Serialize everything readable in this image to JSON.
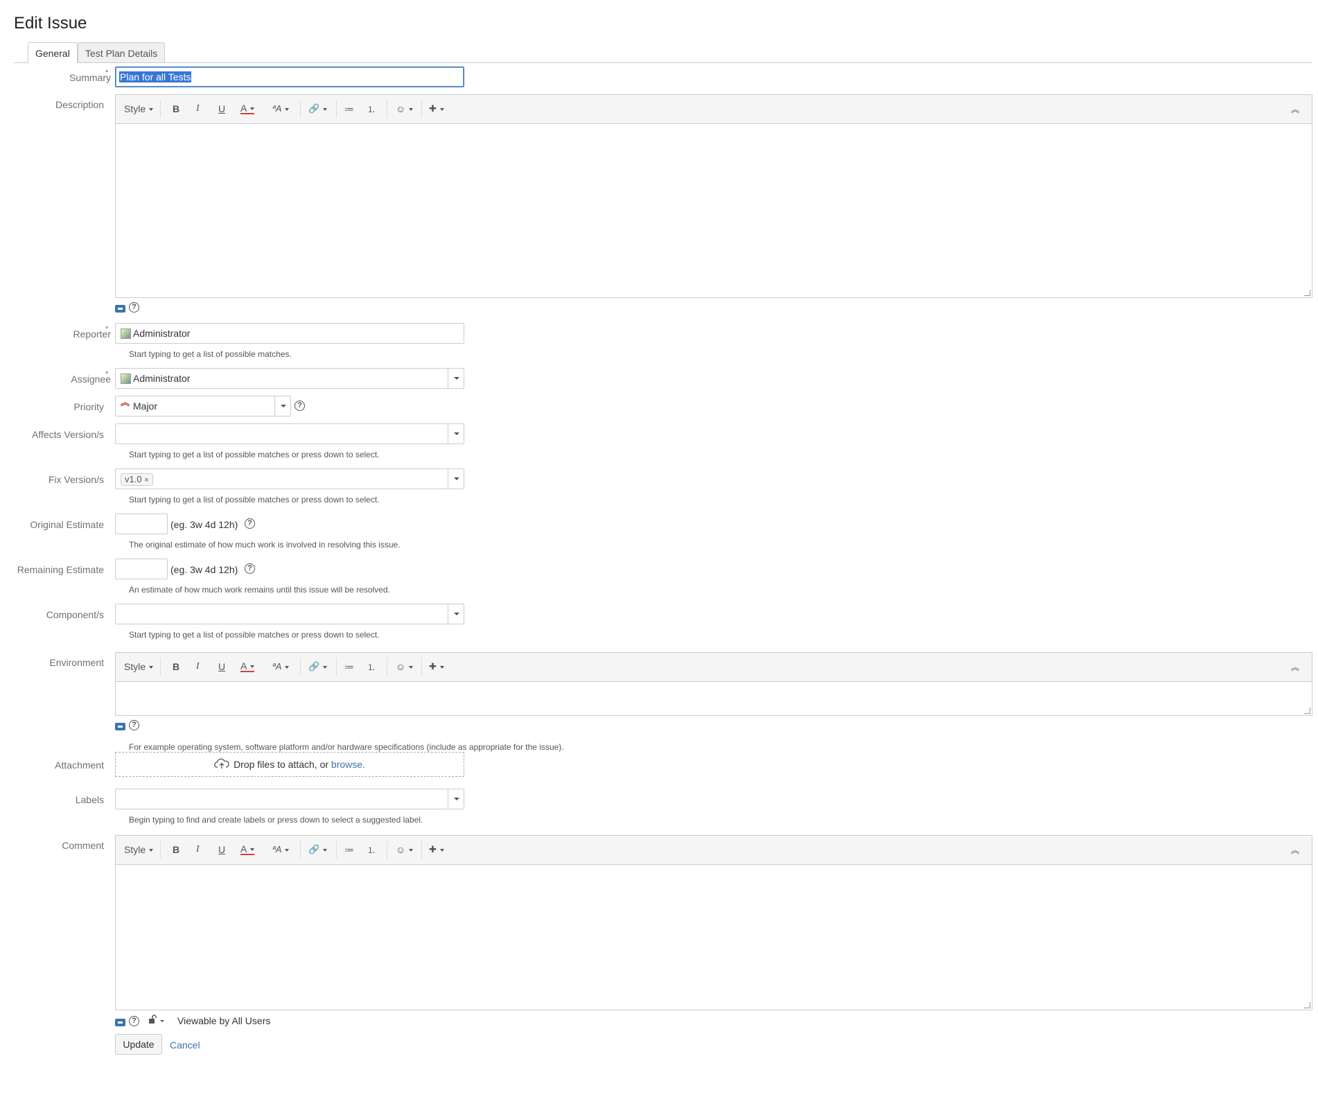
{
  "page": {
    "title": "Edit Issue"
  },
  "tabs": [
    {
      "label": "General",
      "active": true
    },
    {
      "label": "Test Plan Details",
      "active": false
    }
  ],
  "fields": {
    "summary": {
      "label": "Summary",
      "required_mark": "*",
      "value": "Plan for all Tests"
    },
    "description": {
      "label": "Description"
    },
    "reporter": {
      "label": "Reporter",
      "required_mark": "*",
      "value": "Administrator",
      "hint": "Start typing to get a list of possible matches."
    },
    "assignee": {
      "label": "Assignee",
      "required_mark": "*",
      "value": "Administrator"
    },
    "priority": {
      "label": "Priority",
      "value": "Major",
      "color": "#d04437"
    },
    "affects_version": {
      "label": "Affects Version/s",
      "value": "",
      "hint": "Start typing to get a list of possible matches or press down to select."
    },
    "fix_version": {
      "label": "Fix Version/s",
      "tag": "v1.0",
      "tag_remove": "×",
      "hint": "Start typing to get a list of possible matches or press down to select."
    },
    "original_estimate": {
      "label": "Original Estimate",
      "value": "",
      "example": "(eg. 3w 4d 12h)",
      "hint": "The original estimate of how much work is involved in resolving this issue."
    },
    "remaining_estimate": {
      "label": "Remaining Estimate",
      "value": "",
      "example": "(eg. 3w 4d 12h)",
      "hint": "An estimate of how much work remains until this issue will be resolved."
    },
    "components": {
      "label": "Component/s",
      "value": "",
      "hint": "Start typing to get a list of possible matches or press down to select."
    },
    "environment": {
      "label": "Environment",
      "hint": "For example operating system, software platform and/or hardware specifications (include as appropriate for the issue)."
    },
    "attachment": {
      "label": "Attachment",
      "drop_text": "Drop files to attach, or",
      "browse": "browse."
    },
    "labels": {
      "label": "Labels",
      "value": "",
      "hint": "Begin typing to find and create labels or press down to select a suggested label."
    },
    "comment": {
      "label": "Comment",
      "visibility": "Viewable by All Users"
    }
  },
  "toolbar": {
    "style": "Style",
    "bold": "B",
    "italic": "I",
    "underline": "U",
    "text_color": "A",
    "text_effects": "ªA",
    "link": "🔗",
    "bullet_list": "≔",
    "numbered_list": "⒈",
    "emoticon": "☺",
    "insert": "✚",
    "collapse": "︽"
  },
  "help": {
    "glyph": "?"
  },
  "actions": {
    "update": "Update",
    "cancel": "Cancel"
  },
  "colors": {
    "accent": "#3b73af",
    "required": "#d04437",
    "selection": "#3875d7"
  }
}
